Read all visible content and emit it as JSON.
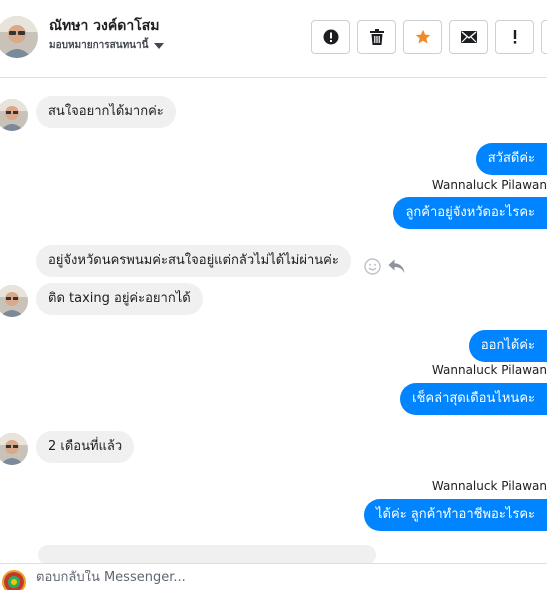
{
  "header": {
    "contact_name": "ณัทษา วงค์ดาโสม",
    "assignment_label": "มอบหมายการสนทนานี้",
    "toolbar": [
      "report",
      "delete",
      "star",
      "mark-unread",
      "mark-important",
      "more"
    ]
  },
  "colors": {
    "outgoing_bubble": "#0084ff",
    "incoming_bubble": "#f1f0f0",
    "star": "#f08a24"
  },
  "messages": [
    {
      "side": "in",
      "text": "สนใจอยากได้มากค่ะ",
      "with_avatar": true
    },
    {
      "side": "out",
      "text": "สวัสดีค่ะ"
    },
    {
      "side": "sender",
      "text": "Wannaluck Pilawan"
    },
    {
      "side": "out",
      "text": "ลูกค้าอยู่จังหวัดอะไรคะ"
    },
    {
      "side": "in",
      "text": "อยู่จังหวัดนครพนมค่ะสนใจอยู่แต่กลัวไม่ได้ไม่ผ่านค่ะ"
    },
    {
      "side": "in",
      "text": "ติด taxing อยู่ค่ะอยากได้",
      "with_avatar": true
    },
    {
      "side": "out",
      "text": "ออกได้ค่ะ"
    },
    {
      "side": "sender",
      "text": "Wannaluck Pilawan"
    },
    {
      "side": "out",
      "text": "เช็คล่าสุดเดือนไหนคะ"
    },
    {
      "side": "in",
      "text": "2 เดือนที่แล้ว",
      "with_avatar": true
    },
    {
      "side": "sender",
      "text": "Wannaluck Pilawan"
    },
    {
      "side": "out",
      "text": "ได้ค่ะ ลูกค้าทำอาชีพอะไรคะ"
    }
  ],
  "reply": {
    "placeholder": "ตอบกลับใน Messenger..."
  }
}
